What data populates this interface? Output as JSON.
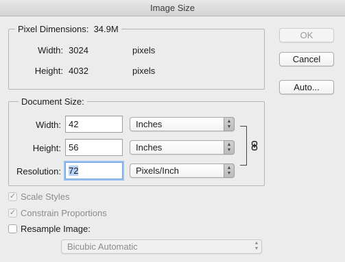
{
  "window": {
    "title": "Image Size"
  },
  "pixel_dimensions": {
    "label": "Pixel Dimensions:",
    "size": "34.9M",
    "width_label": "Width:",
    "width_value": "3024",
    "width_unit": "pixels",
    "height_label": "Height:",
    "height_value": "4032",
    "height_unit": "pixels"
  },
  "document_size": {
    "label": "Document Size:",
    "width_label": "Width:",
    "width_value": "42",
    "width_unit": "Inches",
    "height_label": "Height:",
    "height_value": "56",
    "height_unit": "Inches",
    "resolution_label": "Resolution:",
    "resolution_value": "72",
    "resolution_unit": "Pixels/Inch",
    "link_icon": "chain-link-icon"
  },
  "options": {
    "scale_styles": {
      "label": "Scale Styles",
      "checked": true,
      "enabled": false
    },
    "constrain_proportions": {
      "label": "Constrain Proportions",
      "checked": true,
      "enabled": false
    },
    "resample_image": {
      "label": "Resample Image:",
      "checked": false,
      "enabled": true
    },
    "resample_method": "Bicubic Automatic"
  },
  "buttons": {
    "ok": "OK",
    "cancel": "Cancel",
    "auto": "Auto..."
  },
  "icons": {
    "checkmark": "✓",
    "popup_arrows": "▲▼"
  }
}
